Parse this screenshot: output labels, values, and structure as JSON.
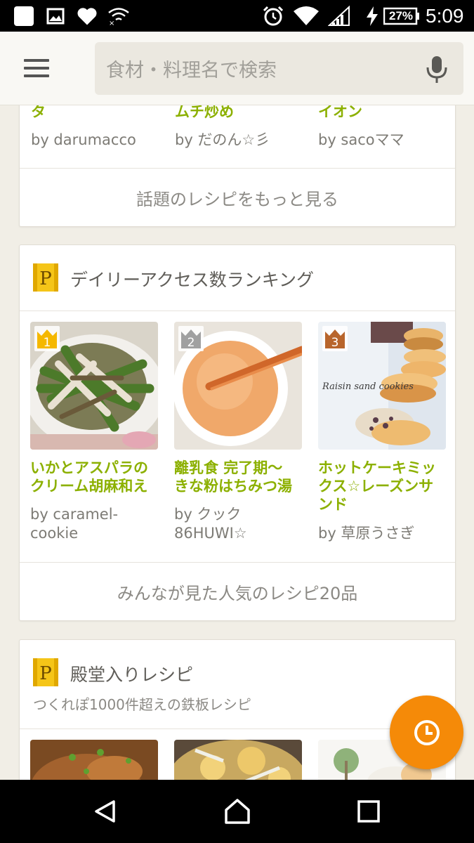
{
  "status_bar": {
    "battery": "27%",
    "time": "5:09"
  },
  "app_bar": {
    "search_placeholder": "食材・料理名で検索"
  },
  "trending": {
    "recipes": [
      {
        "title": "タ",
        "author": "by darumacco"
      },
      {
        "title": "ムチ炒め",
        "author": "by だのん☆彡"
      },
      {
        "title": "イオン",
        "author": "by sacoママ"
      }
    ],
    "more_link": "話題のレシピをもっと見る"
  },
  "ranking": {
    "title": "デイリーアクセス数ランキング",
    "badge_letter": "P",
    "recipes": [
      {
        "rank": "1",
        "title_lines": [
          "いかとアスパラの",
          "クリーム胡麻和え"
        ],
        "author_lines": [
          "by caramel-",
          "cookie"
        ]
      },
      {
        "rank": "2",
        "title_lines": [
          "離乳食 完了期〜",
          "きな粉はちみつ湯"
        ],
        "author_lines": [
          "by クック",
          "86HUWI☆"
        ]
      },
      {
        "rank": "3",
        "title_lines": [
          "ホットケーキミッ",
          "クス☆レーズンサ",
          "ンド"
        ],
        "author_lines": [
          "by 草原うさぎ"
        ],
        "photo_text": "Raisin sand cookies"
      }
    ],
    "more_link": "みんなが見た人気のレシピ20品"
  },
  "hall_of_fame": {
    "title": "殿堂入りレシピ",
    "subtitle": "つくれぽ1000件超えの鉄板レシピ",
    "badge_letter": "P"
  },
  "colors": {
    "accent_green": "#8cb000",
    "fab_orange": "#f58a08",
    "badge_gold": "#f5c518",
    "background": "#f1eee6"
  },
  "icons": {
    "menu": "hamburger-menu-icon",
    "voice": "microphone-icon",
    "fab": "clock-history-icon",
    "nav": [
      "back-icon",
      "home-icon",
      "recents-icon"
    ]
  }
}
